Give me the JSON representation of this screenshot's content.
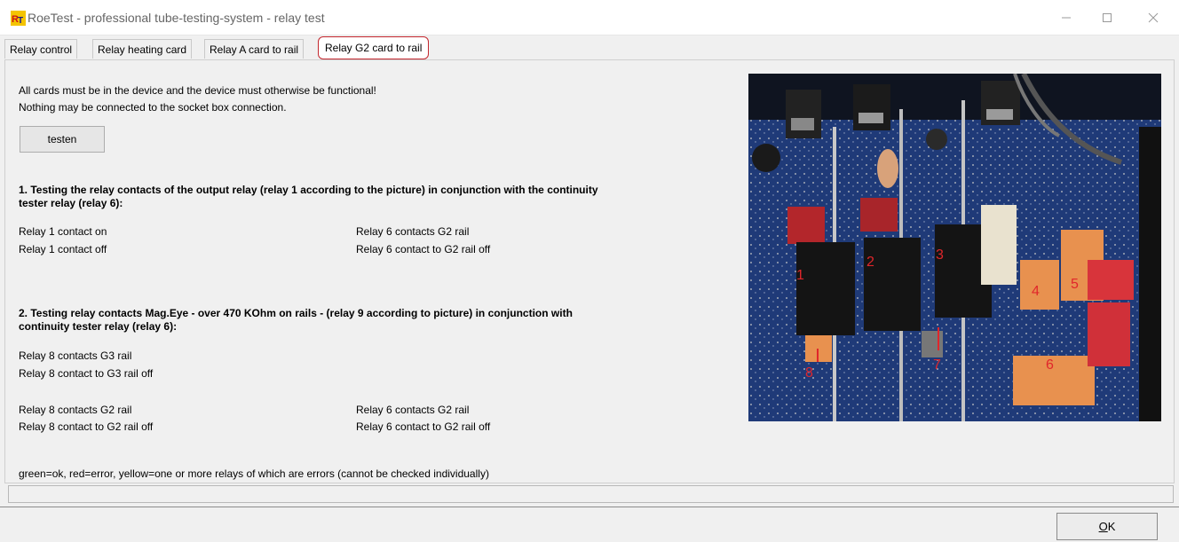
{
  "window": {
    "title": "RoeTest - professional tube-testing-system - relay test",
    "controls": {
      "minimize_icon": "minimize-icon",
      "maximize_icon": "maximize-icon",
      "close_icon": "close-icon"
    }
  },
  "tabs": [
    {
      "label": "Relay control",
      "active": false
    },
    {
      "label": "Relay heating card",
      "active": false
    },
    {
      "label": "Relay A card to rail",
      "active": false
    },
    {
      "label": "Relay G2 card to rail",
      "active": true
    }
  ],
  "intro": {
    "line1": "All cards must be in the device and the device must otherwise be functional!",
    "line2": "Nothing may be connected to the socket box connection."
  },
  "buttons": {
    "test": "testen",
    "ok_accel": "O",
    "ok_rest": "K"
  },
  "section1": {
    "heading_line1": "1. Testing the relay contacts of the output relay (relay 1 according to the picture) in conjunction with the continuity",
    "heading_line2": "tester relay (relay 6):",
    "left": [
      "Relay 1 contact on",
      "Relay 1 contact off"
    ],
    "right": [
      "Relay 6 contacts G2 rail",
      "Relay 6 contact to G2 rail off"
    ]
  },
  "section2": {
    "heading_line1": "2. Testing relay contacts Mag.Eye - over 470 KOhm on rails - (relay 9 according to picture) in conjunction with",
    "heading_line2": "continuity tester relay (relay 6):",
    "g3": [
      "Relay 8 contacts G3 rail",
      "Relay 8 contact to G3 rail off"
    ],
    "g2_left": [
      "Relay 8 contacts G2 rail",
      "Relay 8 contact to G2 rail off"
    ],
    "g2_right": [
      "Relay 6 contacts G2 rail",
      "Relay 6 contact to G2 rail off"
    ]
  },
  "legend": "green=ok, red=error, yellow=one or more relays of which are errors (cannot be checked individually)",
  "photo": {
    "labels": [
      "1",
      "2",
      "3",
      "4",
      "5",
      "6",
      "7",
      "8"
    ],
    "label_color": "#e0262b"
  },
  "colors": {
    "active_tab_border": "#c3272e",
    "window_bg": "#f0f0f0"
  }
}
